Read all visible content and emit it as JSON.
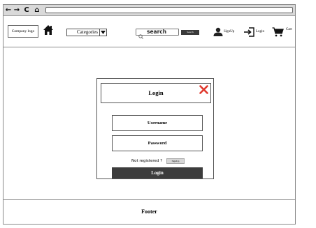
{
  "browser": {
    "nav_icons": {
      "back": "←",
      "forward": "→",
      "reload": "C",
      "home": "⌂"
    },
    "address": ""
  },
  "header": {
    "logo": "Company logo",
    "categories_label": "Categories",
    "search_placeholder": "search",
    "search_button": "Search",
    "signup_label": "SignUp",
    "login_label": "Login",
    "cart_label": "Cart"
  },
  "login_card": {
    "title": "Login",
    "username_label": "Username",
    "password_label": "Password",
    "not_registered": "Not registered ?",
    "signup_button": "SignUp",
    "login_button": "Login"
  },
  "footer": {
    "label": "Footer"
  },
  "colors": {
    "close_icon": "#e03a2f",
    "dark_button": "#3c3c3c",
    "chrome_bar": "#d9d9d9"
  }
}
